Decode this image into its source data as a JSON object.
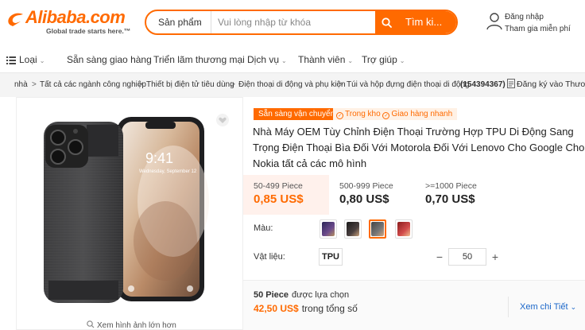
{
  "header": {
    "logo_text": "Alibaba.com",
    "logo_tagline": "Global trade starts here.™",
    "search": {
      "category": "Sản phẩm",
      "placeholder": "Vui lòng nhập từ khóa",
      "button": "Tìm ki..."
    },
    "user": {
      "signin": "Đăng nhập",
      "join": "Tham gia miễn phí"
    }
  },
  "nav": {
    "items": [
      "Loại",
      "Sẵn sàng giao hàng",
      "Triển lãm thương mại",
      "Dịch vụ",
      "Thành viên",
      "Trợ giúp"
    ]
  },
  "breadcrumb": {
    "items": [
      "nhà",
      "Tất cả các ngành công nghiệp",
      "Thiết bị điện tử tiêu dùng",
      "Điện thoại di động và phụ kiện",
      "Túi và hộp đựng điện thoại di động"
    ],
    "item_id": "(154394367)",
    "register": "Đăng ký vào Thươ"
  },
  "product": {
    "zoom_label": "Xem hình ảnh lớn hơn",
    "tags": {
      "ready": "Sẵn sàng vận chuyển",
      "instock": "Trong kho",
      "fast": "Giao hàng nhanh"
    },
    "title": "Nhà Máy OEM Tùy Chỉnh Điện Thoại Trường Hợp TPU Di Động Sang Trọng Điện Thoại Bìa Đối Với Motorola Đối Với Lenovo Cho Google Cho Nokia tất cả các mô hình",
    "price_tiers": [
      {
        "qty": "50-499 Piece",
        "price": "0,85 US$"
      },
      {
        "qty": "500-999 Piece",
        "price": "0,80 US$"
      },
      {
        "qty": ">=1000 Piece",
        "price": "0,70 US$"
      }
    ],
    "color_label": "Màu:",
    "material_label": "Vật liệu:",
    "material_value": "TPU",
    "quantity": "50",
    "summary": {
      "qty_bold": "50 Piece",
      "qty_text": "được lựa chọn",
      "price_bold": "42,50 US$",
      "price_text": "trong tổng số"
    },
    "detail_link": "Xem chi Tiết",
    "phone_time": "9:41",
    "phone_date": "Wednesday, September 12"
  },
  "colors": {
    "brand": "#ff6a00",
    "link": "#1a66c9"
  }
}
